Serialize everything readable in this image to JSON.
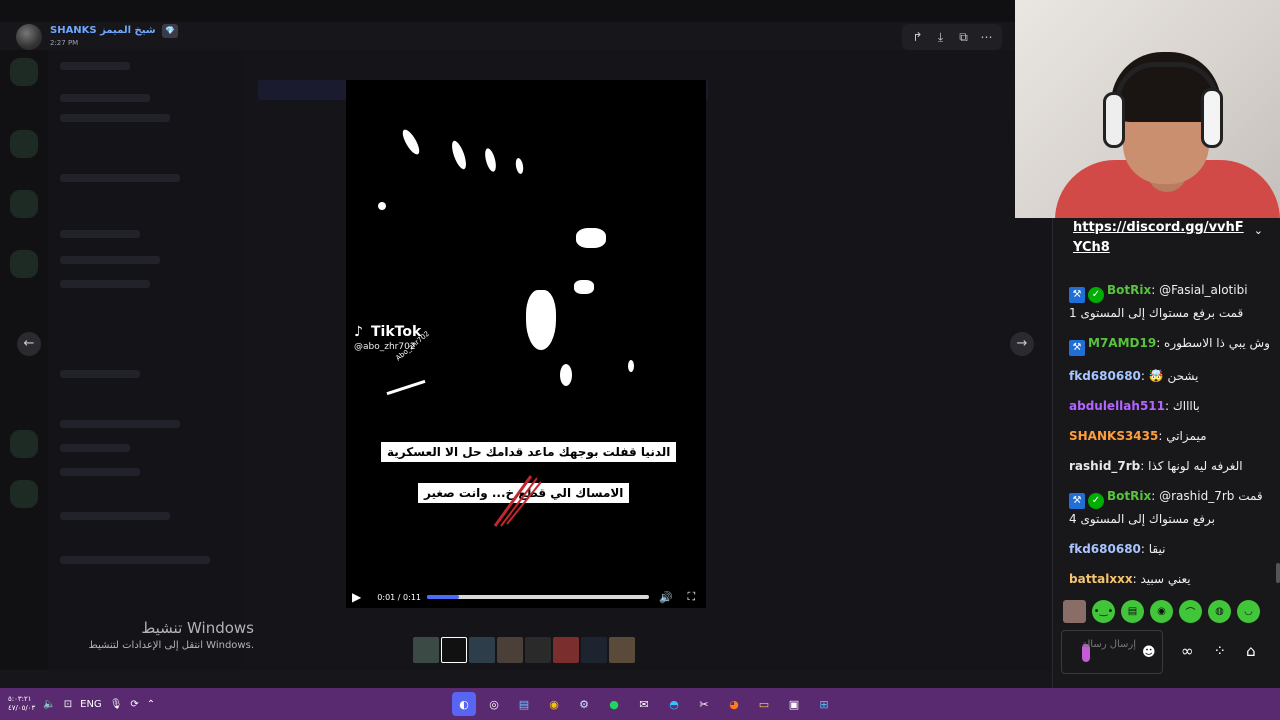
{
  "header": {
    "username": "SHANKS",
    "user_suffix": "شيخ الميمز",
    "badge": "💎",
    "time": "2:27 PM"
  },
  "viewer_toolbar": {
    "icons": [
      "forward-icon",
      "download-icon",
      "open-external-icon",
      "more-icon"
    ],
    "glyphs": [
      "↱",
      "⤓",
      "⧉",
      "⋯"
    ]
  },
  "nav": {
    "prev": "←",
    "next": "→"
  },
  "video": {
    "tiktok_logo": "TikTok",
    "tiktok_handle": "@abo_zhr702",
    "watermark": "Abo_zhr702",
    "caption_1": "الدنيا قفلت بوجهك ماعد قدامك حل الا العسكرية",
    "caption_2": "الامساك الي قطع خ... وانت صغير",
    "time": "0:01 / 0:11",
    "progress": 0.14
  },
  "windows_watermark": {
    "title": "تنشيط Windows",
    "subtitle": "انتقل إلى الإعدادات لتنشيط Windows."
  },
  "chat": {
    "pinned_link": "https://discord.gg/vvhFYCh8",
    "messages": [
      {
        "user": "BotRix",
        "color": "#58c33c",
        "badges": true,
        "text": "@Fasial_alotibi قمت برفع مستواك إلى المستوى 1"
      },
      {
        "user": "M7AMD19",
        "color": "#58c33c",
        "badges": "mod",
        "text": "وش يبي ذا الاسطوره"
      },
      {
        "user": "fkd680680",
        "color": "#a8c4ff",
        "badges": false,
        "text": "يشحن 🤯"
      },
      {
        "user": "abdulellah511",
        "color": "#b366ff",
        "badges": false,
        "text": "بااااك"
      },
      {
        "user": "SHANKS3435",
        "color": "#ff9e3d",
        "badges": false,
        "text": "ميمزاتي"
      },
      {
        "user": "rashid_7rb",
        "color": "#e8e8e8",
        "badges": false,
        "text": "الغرفه ليه لونها كذا"
      },
      {
        "user": "BotRix",
        "color": "#58c33c",
        "badges": true,
        "text": "@rashid_7rb قمت برفع مستواك إلى المستوى 4"
      },
      {
        "user": "fkd680680",
        "color": "#a8c4ff",
        "badges": false,
        "text": "نيقا"
      },
      {
        "user": "battalxxx",
        "color": "#f5c46e",
        "badges": false,
        "text": "يعني سبيد"
      }
    ],
    "input_placeholder": "إرسال رسالة",
    "emoji_glyph": "☻",
    "icons_glyphs": [
      "∞",
      "⁘",
      "⌂"
    ]
  },
  "taskbar": {
    "clock_time": "٥:٠٣:٢١",
    "clock_date": "٤٧/٠٥/٠٣",
    "lang": "ENG",
    "apps": [
      "discord-icon",
      "obs-icon",
      "notepad-icon",
      "chrome-icon",
      "steam-icon",
      "spotify-icon",
      "mail-icon",
      "edge-icon",
      "capcut-icon",
      "firefox-icon",
      "file-explorer-icon",
      "window-icon",
      "windows-start-icon"
    ]
  }
}
